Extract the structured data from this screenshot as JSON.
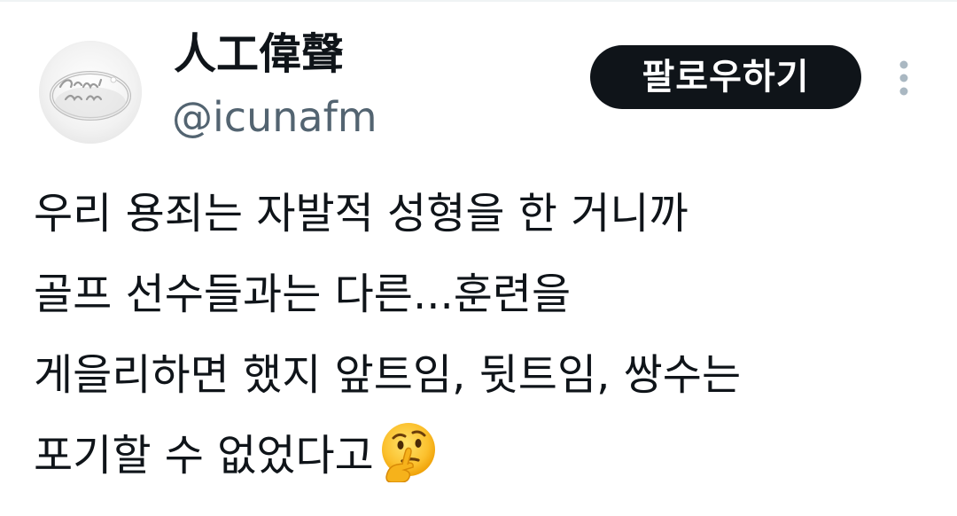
{
  "tweet": {
    "author": {
      "display_name": "人工偉聲",
      "handle": "@icunafm",
      "avatar_icon": "ring-icon",
      "avatar_engraving": "fuck you"
    },
    "follow_label": "팔로우하기",
    "more_icon": "more-vertical-icon",
    "body_lines": [
      "우리 용죄는 자발적 성형을 한 거니까",
      "골프 선수들과는 다른...훈련을",
      "게을리하면 했지 앞트임, 뒷트임, 쌍수는",
      "포기할 수 없었다고"
    ],
    "trailing_emoji": "thinking-face-emoji"
  },
  "colors": {
    "text_primary": "#0f1419",
    "text_secondary": "#536471",
    "button_bg": "#0f1419",
    "button_text": "#ffffff",
    "background": "#ffffff"
  }
}
